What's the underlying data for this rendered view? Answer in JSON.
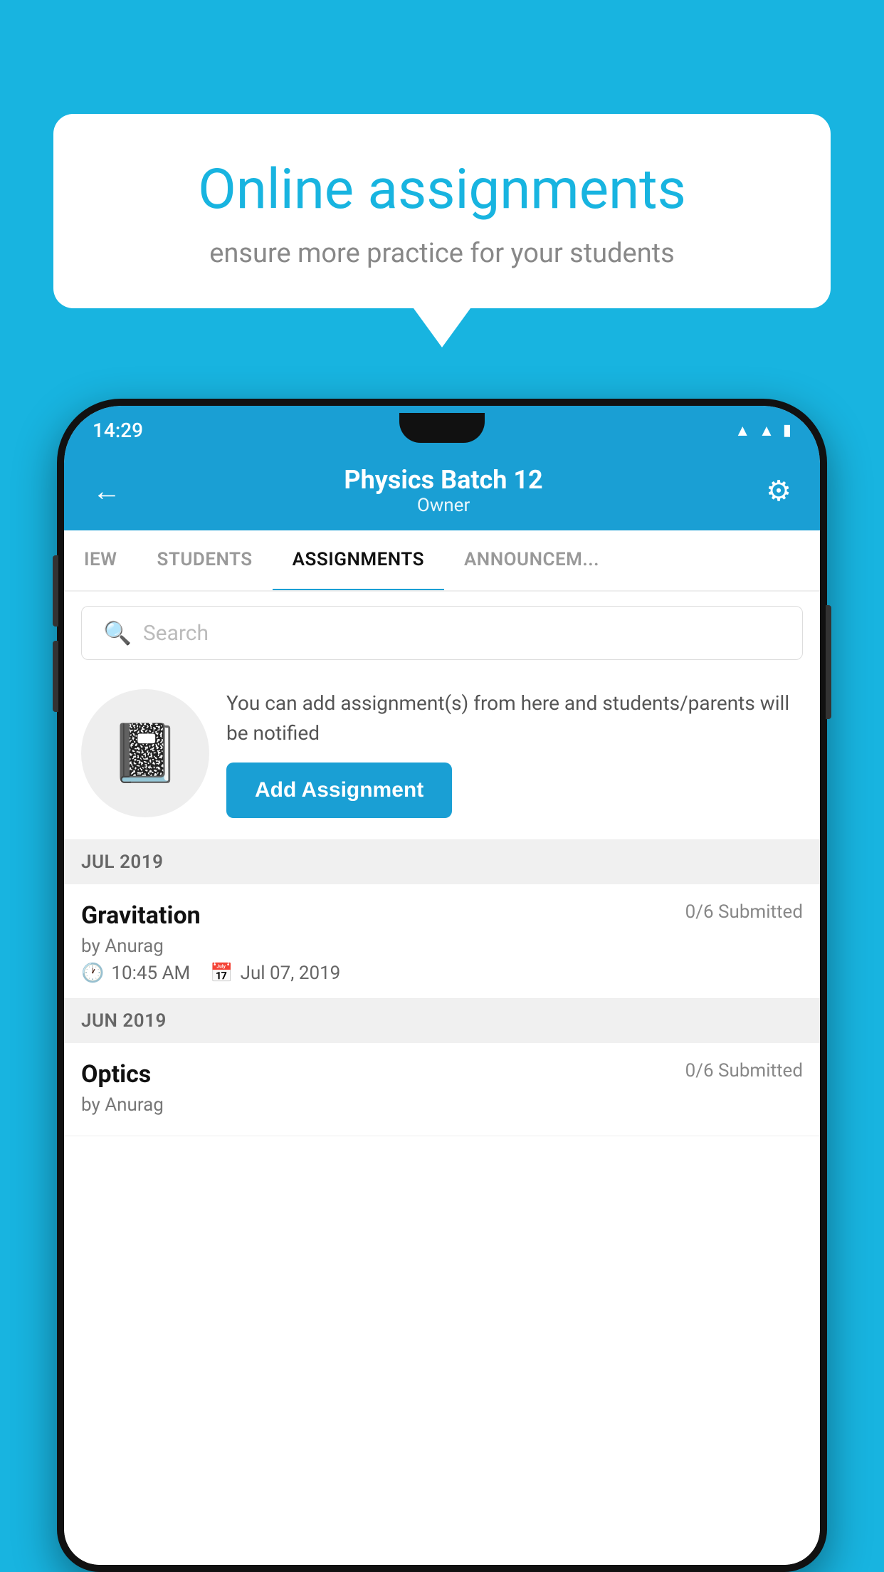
{
  "background_color": "#18b4e0",
  "speech_bubble": {
    "title": "Online assignments",
    "subtitle": "ensure more practice for your students"
  },
  "status_bar": {
    "time": "14:29",
    "icons": [
      "wifi",
      "signal",
      "battery"
    ]
  },
  "app_header": {
    "title": "Physics Batch 12",
    "subtitle": "Owner",
    "back_label": "←",
    "settings_label": "⚙"
  },
  "tabs": [
    {
      "label": "IEW",
      "active": false
    },
    {
      "label": "STUDENTS",
      "active": false
    },
    {
      "label": "ASSIGNMENTS",
      "active": true
    },
    {
      "label": "ANNOUNCEM...",
      "active": false
    }
  ],
  "search": {
    "placeholder": "Search"
  },
  "promo": {
    "description": "You can add assignment(s) from here and students/parents will be notified",
    "button_label": "Add Assignment"
  },
  "sections": [
    {
      "header": "JUL 2019",
      "assignments": [
        {
          "name": "Gravitation",
          "submitted": "0/6 Submitted",
          "author": "by Anurag",
          "time": "10:45 AM",
          "date": "Jul 07, 2019"
        }
      ]
    },
    {
      "header": "JUN 2019",
      "assignments": [
        {
          "name": "Optics",
          "submitted": "0/6 Submitted",
          "author": "by Anurag",
          "time": "",
          "date": ""
        }
      ]
    }
  ]
}
